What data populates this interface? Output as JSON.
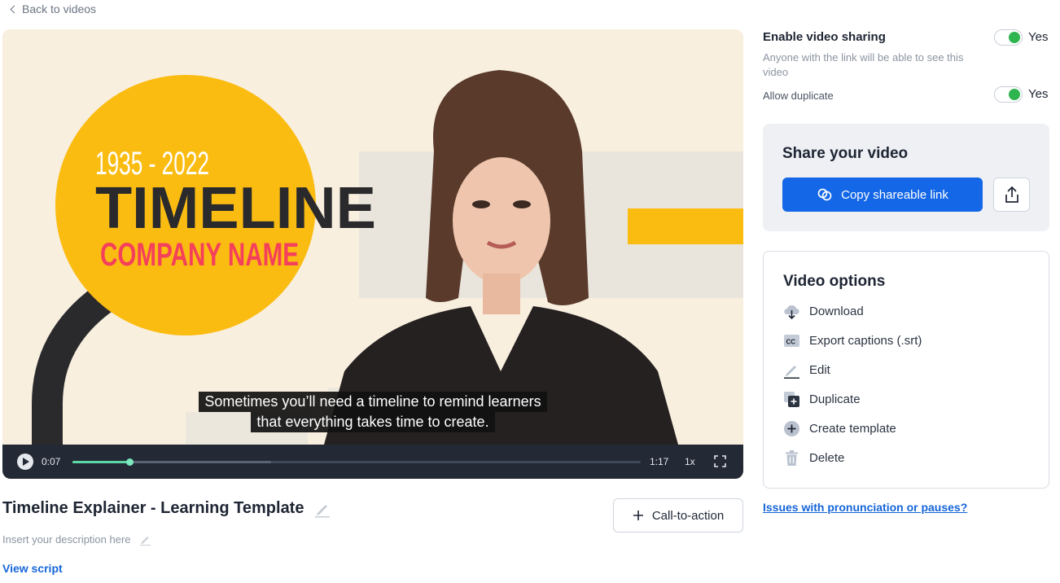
{
  "nav": {
    "back_label": "Back to videos"
  },
  "video": {
    "scene_year_range": "1935 - 2022",
    "scene_heading": "TIMELINE",
    "scene_company": "COMPANY NAME",
    "caption_line1": "Sometimes you’ll need a timeline to remind learners",
    "caption_line2": "that everything takes time to create.",
    "current_time": "0:07",
    "total_time": "1:17",
    "speed": "1x",
    "progress_fraction": 0.1,
    "buffer_fraction": 0.35
  },
  "details": {
    "title": "Timeline Explainer - Learning Template",
    "description_placeholder": "Insert your description here",
    "view_script": "View script",
    "cta_label": "Call-to-action"
  },
  "sharing": {
    "enable_label": "Enable video sharing",
    "enable_sub": "Anyone with the link will be able to see this video",
    "enable_value": "Yes",
    "duplicate_label": "Allow duplicate",
    "duplicate_value": "Yes",
    "toggle_on_color": "#2fb550"
  },
  "share_card": {
    "title": "Share your video",
    "copy_label": "Copy shareable link"
  },
  "options": {
    "title": "Video options",
    "items": [
      {
        "label": "Download",
        "icon": "cloud-download-icon"
      },
      {
        "label": "Export captions (.srt)",
        "icon": "captions-icon"
      },
      {
        "label": "Edit",
        "icon": "pencil-icon"
      },
      {
        "label": "Duplicate",
        "icon": "duplicate-icon"
      },
      {
        "label": "Create template",
        "icon": "plus-circle-icon"
      },
      {
        "label": "Delete",
        "icon": "trash-icon"
      }
    ]
  },
  "help": {
    "issues_link": "Issues with pronunciation or pauses?"
  },
  "colors": {
    "accent": "#1467e6",
    "progress": "#5cd6a5",
    "scene_yellow": "#fbbc12",
    "scene_red": "#f4405b"
  }
}
